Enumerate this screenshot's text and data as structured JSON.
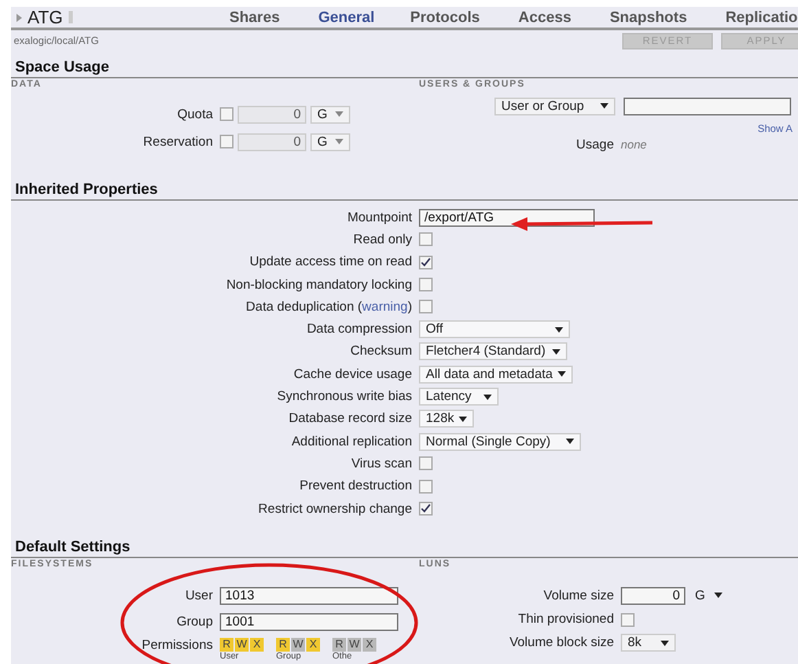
{
  "header": {
    "title": "ATG",
    "tabs": [
      {
        "label": "Shares",
        "selected": false
      },
      {
        "label": "General",
        "selected": true
      },
      {
        "label": "Protocols",
        "selected": false
      },
      {
        "label": "Access",
        "selected": false
      },
      {
        "label": "Snapshots",
        "selected": false
      },
      {
        "label": "Replicatio",
        "selected": false
      }
    ]
  },
  "path": "exalogic/local/ATG",
  "actions": [
    {
      "label": "REVERT",
      "disabled": true
    },
    {
      "label": "APPLY",
      "disabled": true
    }
  ],
  "space_usage": {
    "title": "Space Usage",
    "data_heading": "DATA",
    "users_heading": "USERS & GROUPS",
    "rows": [
      {
        "label": "Quota",
        "checked": false,
        "value": "0",
        "unit": "G"
      },
      {
        "label": "Reservation",
        "checked": false,
        "value": "0",
        "unit": "G"
      }
    ],
    "user_select": "User or Group",
    "show_link": "Show A",
    "usage_label": "Usage",
    "usage_value": "none"
  },
  "inherited": {
    "title": "Inherited Properties",
    "rows": [
      {
        "kind": "text",
        "label": "Mountpoint",
        "value": "/export/ATG"
      },
      {
        "kind": "checkbox",
        "label": "Read only",
        "checked": false
      },
      {
        "kind": "checkbox",
        "label": "Update access time on read",
        "checked": true
      },
      {
        "kind": "checkbox",
        "label": "Non-blocking mandatory locking",
        "checked": false
      },
      {
        "kind": "checkbox",
        "label": "Data deduplication (",
        "link": "warning",
        "label_end": ")",
        "checked": false
      },
      {
        "kind": "select",
        "label": "Data compression",
        "value": "Off"
      },
      {
        "kind": "select",
        "label": "Checksum",
        "value": "Fletcher4 (Standard)"
      },
      {
        "kind": "select",
        "label": "Cache device usage",
        "value": "All data and metadata"
      },
      {
        "kind": "select",
        "label": "Synchronous write bias",
        "value": "Latency"
      },
      {
        "kind": "select",
        "label": "Database record size",
        "value": "128k"
      },
      {
        "kind": "select",
        "label": "Additional replication",
        "value": "Normal (Single Copy)"
      },
      {
        "kind": "checkbox",
        "label": "Virus scan",
        "checked": false
      },
      {
        "kind": "checkbox",
        "label": "Prevent destruction",
        "checked": false
      },
      {
        "kind": "checkbox",
        "label": "Restrict ownership change",
        "checked": true
      }
    ]
  },
  "defaults": {
    "title": "Default Settings",
    "fs_heading": "FILESYSTEMS",
    "luns_heading": "LUNS",
    "user_label": "User",
    "user_value": "1013",
    "group_label": "Group",
    "group_value": "1001",
    "permissions_label": "Permissions",
    "permissions": [
      {
        "label": "User",
        "bits": [
          {
            "letter": "R",
            "on": true
          },
          {
            "letter": "W",
            "on": true
          },
          {
            "letter": "X",
            "on": true
          }
        ]
      },
      {
        "label": "Group",
        "bits": [
          {
            "letter": "R",
            "on": true
          },
          {
            "letter": "W",
            "on": false
          },
          {
            "letter": "X",
            "on": true
          }
        ]
      },
      {
        "label": "Othe",
        "bits": [
          {
            "letter": "R",
            "on": false
          },
          {
            "letter": "W",
            "on": false
          },
          {
            "letter": "X",
            "on": false
          }
        ]
      }
    ],
    "volume_size_label": "Volume size",
    "volume_size": "0",
    "volume_unit": "G",
    "thin_label": "Thin provisioned",
    "thin_checked": false,
    "block_label": "Volume block size",
    "block_value": "8k"
  }
}
